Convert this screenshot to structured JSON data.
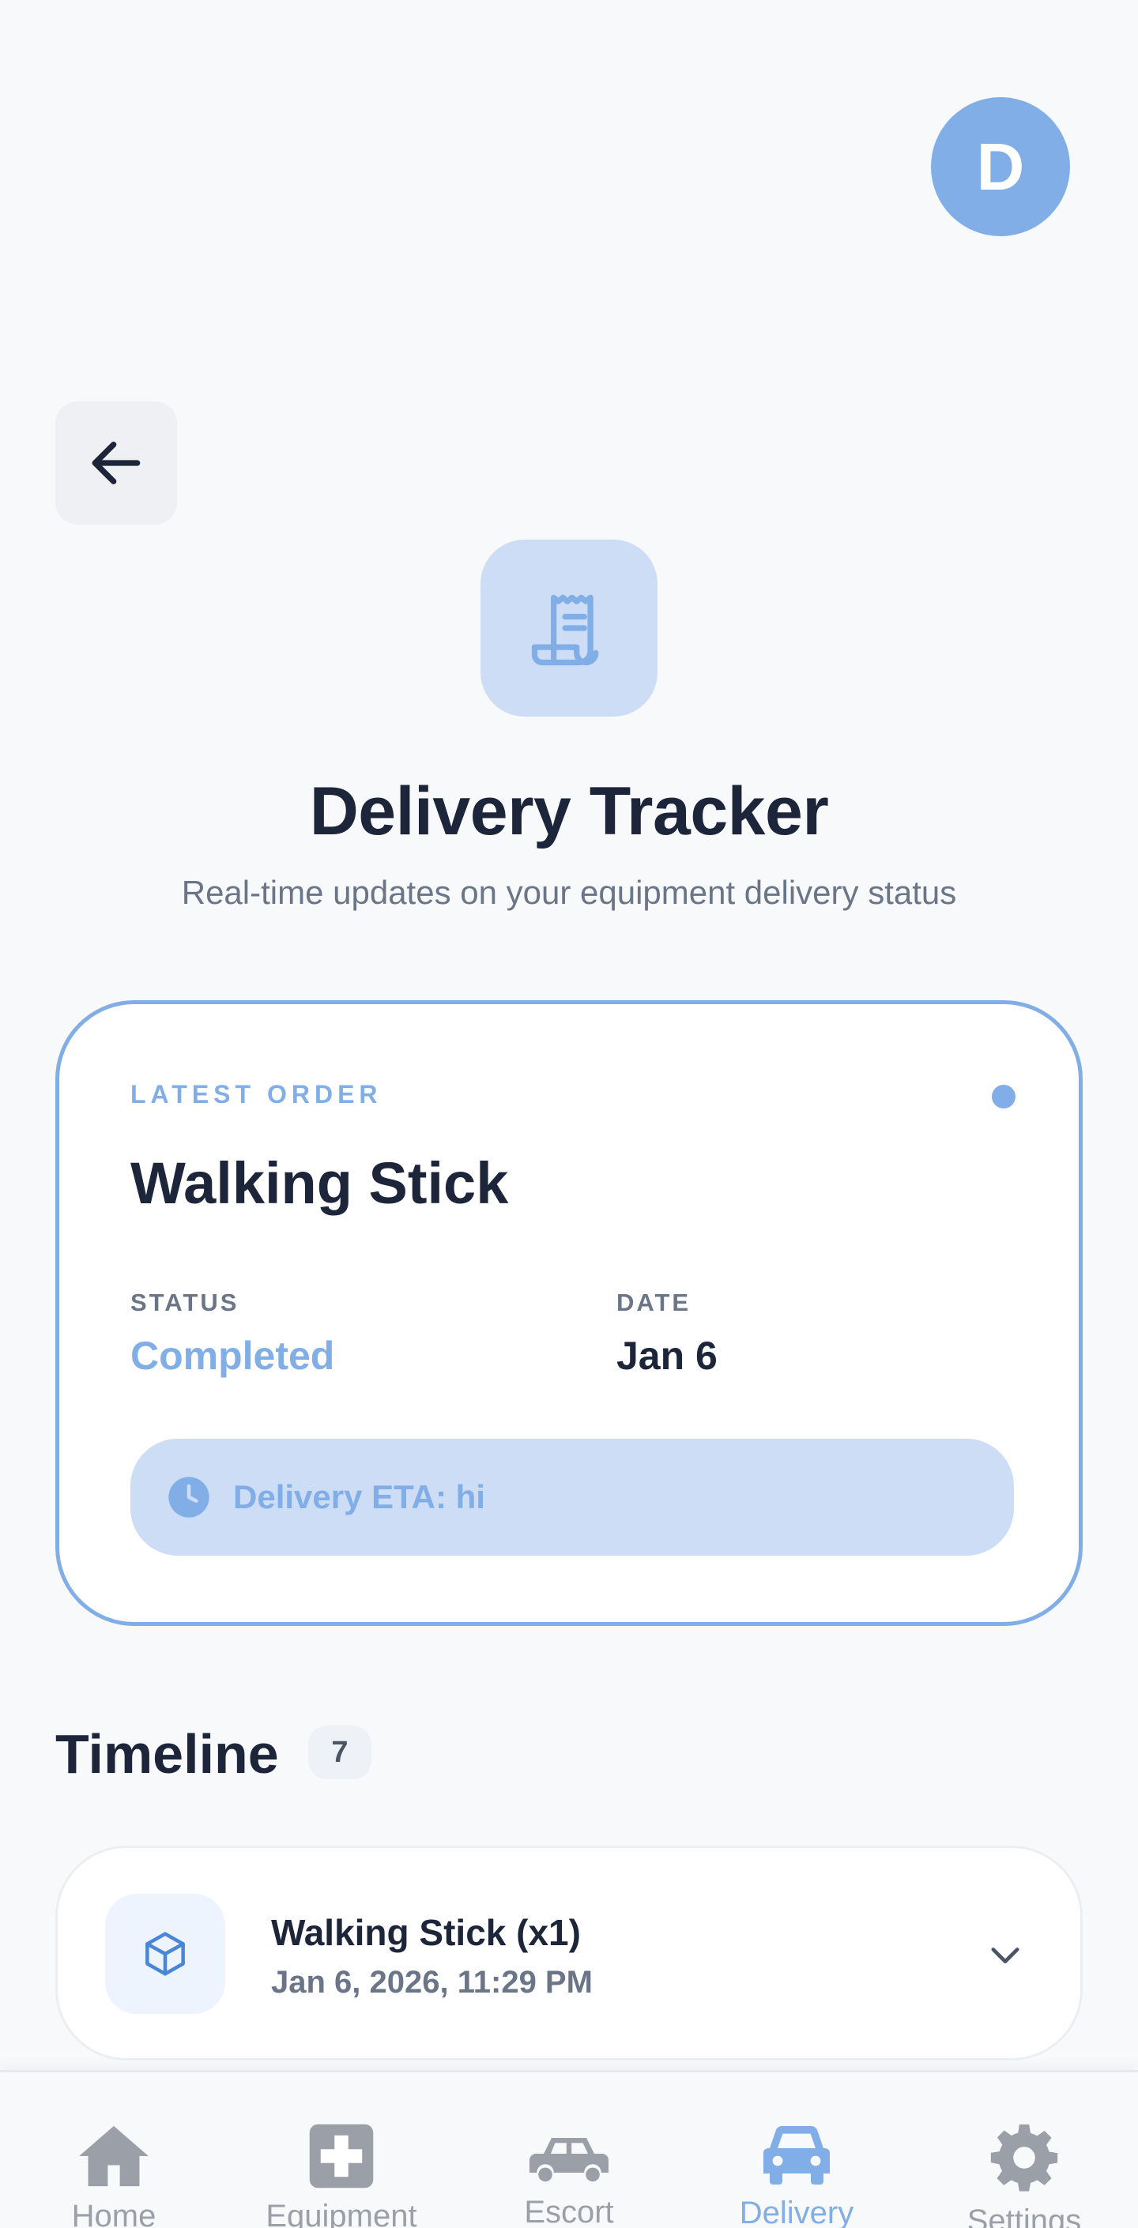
{
  "header": {
    "avatar_initial": "D"
  },
  "hero": {
    "title": "Delivery Tracker",
    "subtitle": "Real-time updates on your equipment delivery status"
  },
  "latest_order": {
    "eyebrow": "LATEST ORDER",
    "item_name": "Walking Stick",
    "status_label": "STATUS",
    "status_value": "Completed",
    "date_label": "DATE",
    "date_value": "Jan 6",
    "eta_text": "Delivery ETA: hi"
  },
  "timeline": {
    "title": "Timeline",
    "count": "7",
    "items": [
      {
        "title": "Walking Stick (x1)",
        "datetime": "Jan 6, 2026, 11:29 PM",
        "icon": "box-icon"
      }
    ]
  },
  "bottom_nav": {
    "items": [
      {
        "label": "Home",
        "icon": "home-icon",
        "active": false
      },
      {
        "label": "Equipment",
        "icon": "medical-plus-icon",
        "active": false
      },
      {
        "label": "Escort",
        "icon": "car-icon",
        "active": false
      },
      {
        "label": "Delivery",
        "icon": "car-icon",
        "active": true
      },
      {
        "label": "Settings",
        "icon": "gear-icon",
        "active": false
      }
    ]
  },
  "colors": {
    "accent": "#81AEE6",
    "accent_soft": "#CCDDF5",
    "text_primary": "#1C2539",
    "text_secondary": "#6A7587",
    "nav_inactive": "#9A9FA8",
    "background": "#F8F9FB"
  }
}
